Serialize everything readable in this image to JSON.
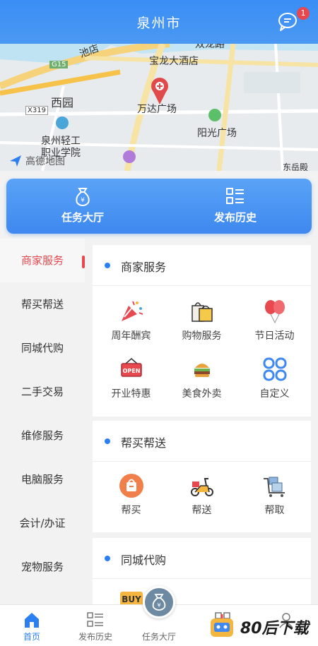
{
  "header": {
    "title": "泉州市",
    "message_badge": "1"
  },
  "map": {
    "labels": [
      "池店",
      "双龙路",
      "宝龙大酒店",
      "G15",
      "西园",
      "万达广场",
      "X319",
      "阳光广场",
      "泉州轻工",
      "职业学院",
      "高德地图",
      "东岳殿"
    ]
  },
  "quick": [
    {
      "label": "任务大厅",
      "icon": "money-bag-icon"
    },
    {
      "label": "发布历史",
      "icon": "list-icon"
    }
  ],
  "sidebar": [
    {
      "label": "商家服务"
    },
    {
      "label": "帮买帮送"
    },
    {
      "label": "同城代购"
    },
    {
      "label": "二手交易"
    },
    {
      "label": "维修服务"
    },
    {
      "label": "电脑服务"
    },
    {
      "label": "会计/办证"
    },
    {
      "label": "宠物服务"
    }
  ],
  "sections": [
    {
      "title": "商家服务",
      "items": [
        {
          "label": "周年酬宾",
          "icon": "party-popper-icon"
        },
        {
          "label": "购物服务",
          "icon": "shopping-bag-icon"
        },
        {
          "label": "节日活动",
          "icon": "balloon-icon"
        },
        {
          "label": "开业特惠",
          "icon": "open-sign-icon"
        },
        {
          "label": "美食外卖",
          "icon": "burger-icon"
        },
        {
          "label": "自定义",
          "icon": "grid-icon"
        }
      ]
    },
    {
      "title": "帮买帮送",
      "items": [
        {
          "label": "帮买",
          "icon": "bag-icon"
        },
        {
          "label": "帮送",
          "icon": "scooter-icon"
        },
        {
          "label": "帮取",
          "icon": "cart-boxes-icon"
        }
      ]
    },
    {
      "title": "同城代购",
      "items": [
        {
          "label": "BUY",
          "icon": "buy-icon"
        }
      ]
    }
  ],
  "tabbar": [
    {
      "label": "首页",
      "icon": "home-icon"
    },
    {
      "label": "发布历史",
      "icon": "list-icon"
    },
    {
      "label": "任务大厅",
      "icon": "money-bag-icon"
    },
    {
      "label": "",
      "icon": "qr-code-icon"
    },
    {
      "label": "",
      "icon": "user-icon"
    }
  ],
  "watermark": "80后下载",
  "colors": {
    "primary": "#3a8ef5",
    "accent": "#e6484e"
  }
}
